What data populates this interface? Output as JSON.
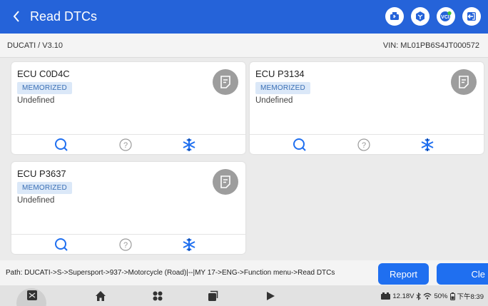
{
  "header": {
    "title": "Read DTCs",
    "color": "#2563d9",
    "icons": [
      "bluetooth-print-icon",
      "vehicle-model-icon",
      "vci-connection-icon",
      "exit-icon"
    ]
  },
  "info": {
    "vehicle": "DUCATI / V3.10",
    "vin": "VIN: ML01PB6S4JT000572"
  },
  "cards": [
    {
      "code": "ECU C0D4C",
      "badge": "MEMORIZED",
      "status": "Undefined"
    },
    {
      "code": "ECU P3134",
      "badge": "MEMORIZED",
      "status": "Undefined"
    },
    {
      "code": "ECU P3637",
      "badge": "MEMORIZED",
      "status": "Undefined"
    }
  ],
  "path": {
    "text": "Path: DUCATI->S->Supersport->937->Motorcycle (Road)|--|MY 17->ENG->Function menu->Read DTCs"
  },
  "buttons": {
    "report": "Report",
    "clear": "Cle"
  },
  "status": {
    "voltage": "12.18V",
    "battery": "50%",
    "time": "下午8:39"
  },
  "colors": {
    "accent": "#1f6ff0",
    "badge_bg": "#dbe8f8",
    "badge_text": "#3a6fb5",
    "doc_button": "#9d9d9d"
  }
}
